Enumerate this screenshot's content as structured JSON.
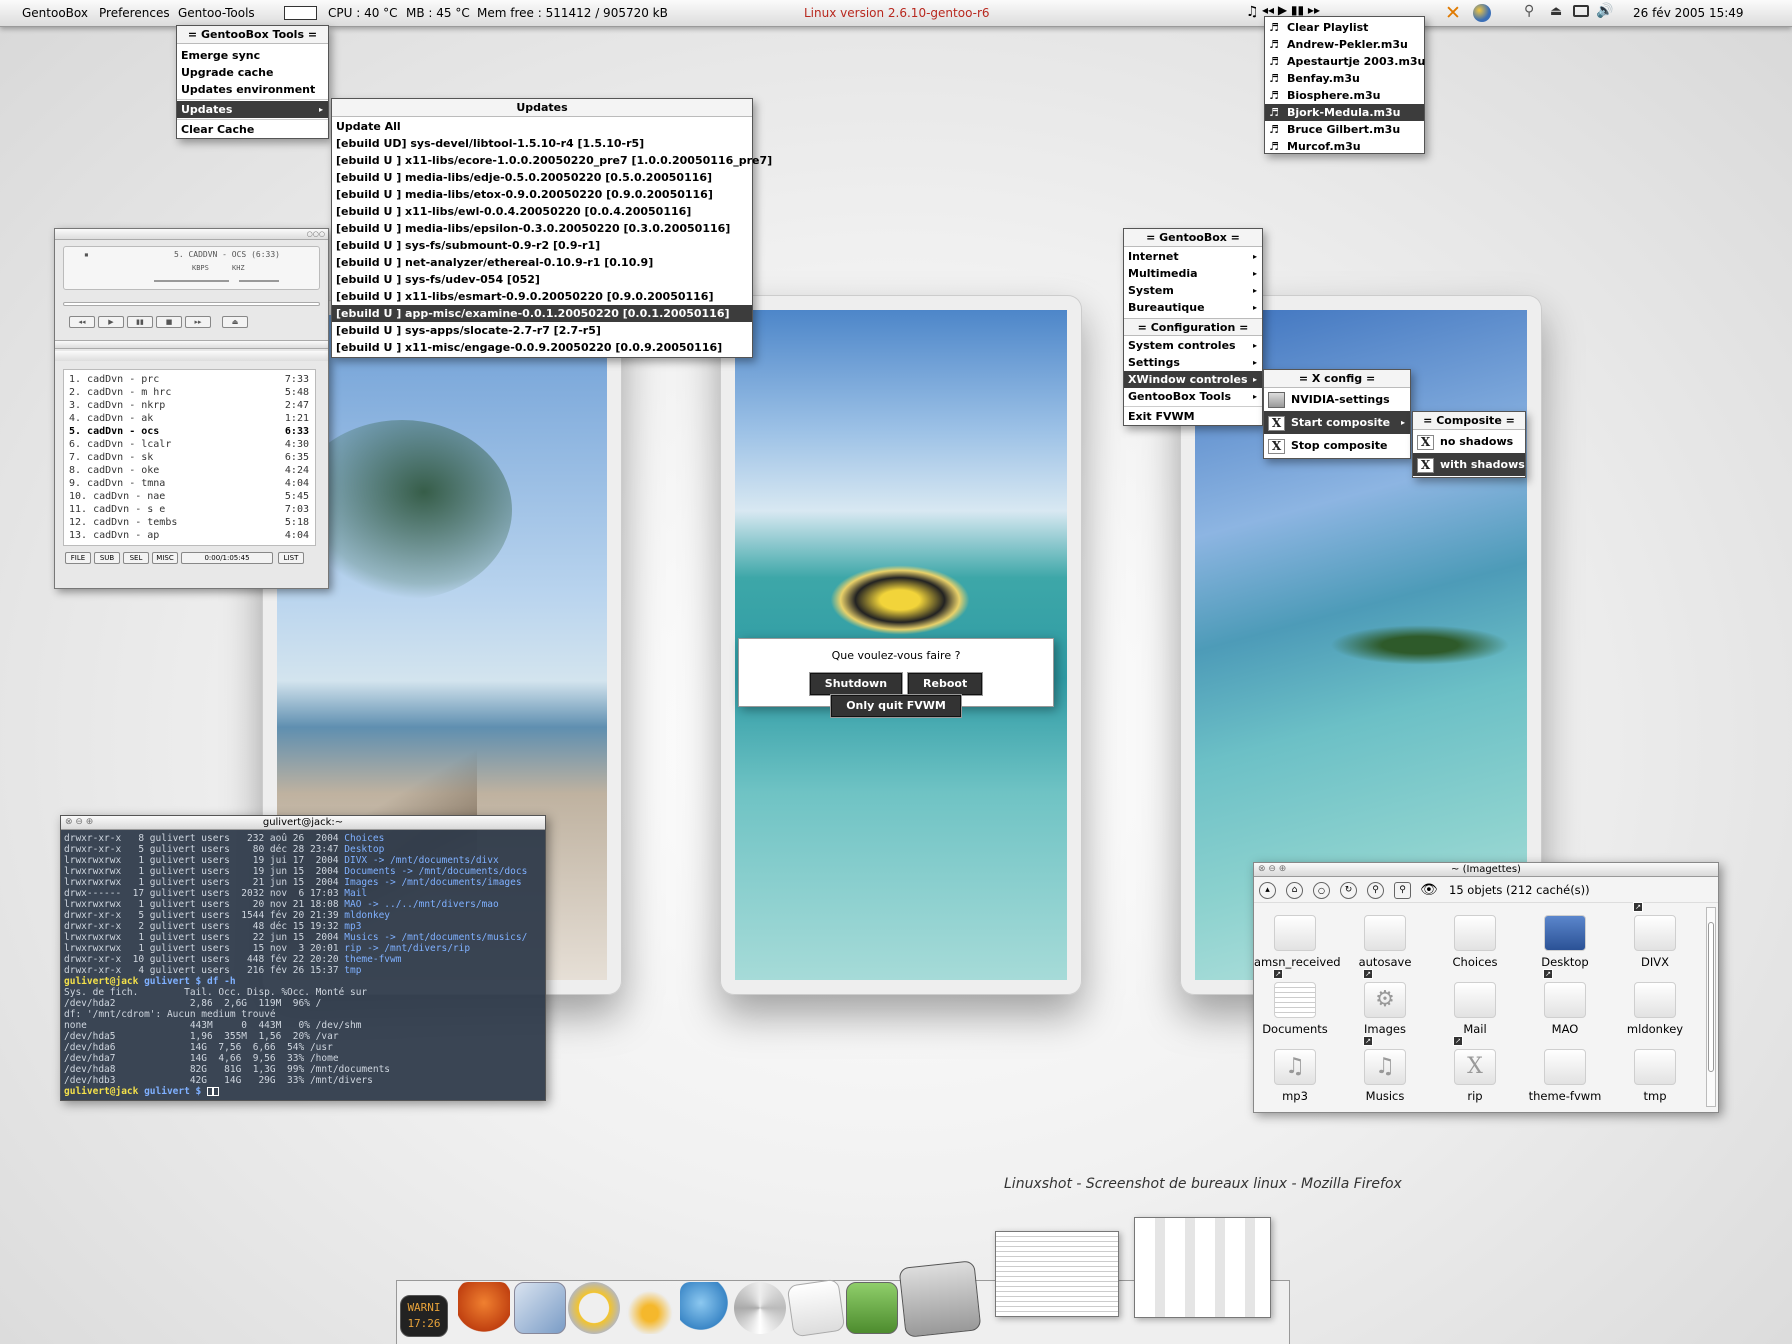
{
  "topbar": {
    "gentoobox": "GentooBox",
    "preferences": "Preferences",
    "gentoo_tools": "Gentoo-Tools",
    "cpu": "CPU : 40 °C",
    "mb": "MB : 45 °C",
    "mem": "Mem free : 511412 / 905720 kB",
    "kernel": "Linux version 2.6.10-gentoo-r6",
    "datetime": "26 fév 2005  15:49"
  },
  "tools_menu": {
    "title": "= GentooBox Tools =",
    "items": [
      "Emerge sync",
      "Upgrade cache",
      "Updates environment",
      "Updates",
      "Clear Cache"
    ]
  },
  "updates_menu": {
    "title": "Updates",
    "items": [
      "Update All",
      "[ebuild   UD] sys-devel/libtool-1.5.10-r4 [1.5.10-r5]",
      "[ebuild   U ] x11-libs/ecore-1.0.0.20050220_pre7 [1.0.0.20050116_pre7]",
      "[ebuild   U ] media-libs/edje-0.5.0.20050220 [0.5.0.20050116]",
      "[ebuild   U ] media-libs/etox-0.9.0.20050220 [0.9.0.20050116]",
      "[ebuild   U ] x11-libs/ewl-0.0.4.20050220 [0.0.4.20050116]",
      "[ebuild   U ] media-libs/epsilon-0.3.0.20050220 [0.3.0.20050116]",
      "[ebuild   U ] sys-fs/submount-0.9-r2 [0.9-r1]",
      "[ebuild   U ] net-analyzer/ethereal-0.10.9-r1 [0.10.9]",
      "[ebuild   U ] sys-fs/udev-054 [052]",
      "[ebuild   U ] x11-libs/esmart-0.9.0.20050220 [0.9.0.20050116]",
      "[ebuild   U ] app-misc/examine-0.0.1.20050220 [0.0.1.20050116]",
      "[ebuild   U ] sys-apps/slocate-2.7-r7 [2.7-r5]",
      "[ebuild   U ] x11-misc/engage-0.0.9.20050220 [0.0.9.20050116]"
    ]
  },
  "playlist_menu": {
    "items": [
      "Clear Playlist",
      "Andrew-Pekler.m3u",
      "Apestaurtje 2003.m3u",
      "Benfay.m3u",
      "Biosphere.m3u",
      "Bjork-Medula.m3u",
      "Bruce Gilbert.m3u",
      "Murcof.m3u"
    ]
  },
  "gb_menu": {
    "title": "= GentooBox =",
    "items": [
      "Internet",
      "Multimedia",
      "System",
      "Bureautique"
    ],
    "config_title": "= Configuration =",
    "config_items": [
      "System controles",
      "Settings",
      "XWindow controles",
      "GentooBox Tools"
    ],
    "exit": "Exit FVWM"
  },
  "xconfig_menu": {
    "title": "= X config =",
    "items": [
      "NVIDIA-settings",
      "Start composite",
      "Stop composite"
    ]
  },
  "composite_menu": {
    "title": "= Composite =",
    "items": [
      "no shadows",
      "with shadows"
    ]
  },
  "xmms": {
    "display": "5. CADDVN - OCS (6:33)",
    "kbps": "KBPS",
    "khz": "KHZ",
    "tracks": [
      {
        "n": "1. cadDvn - prc",
        "t": "7:33"
      },
      {
        "n": "2. cadDvn - m hrc",
        "t": "5:48"
      },
      {
        "n": "3. cadDvn - nkrp",
        "t": "2:47"
      },
      {
        "n": "4. cadDvn - ak",
        "t": "1:21"
      },
      {
        "n": "5. cadDvn - ocs",
        "t": "6:33"
      },
      {
        "n": "6. cadDvn - lcalr",
        "t": "4:30"
      },
      {
        "n": "7. cadDvn - sk",
        "t": "6:35"
      },
      {
        "n": "8. cadDvn - oke",
        "t": "4:24"
      },
      {
        "n": "9. cadDvn - tmna",
        "t": "4:04"
      },
      {
        "n": "10. cadDvn - nae",
        "t": "5:45"
      },
      {
        "n": "11. cadDvn - s e",
        "t": "7:03"
      },
      {
        "n": "12. cadDvn - tembs",
        "t": "5:18"
      },
      {
        "n": "13. cadDvn -  ap",
        "t": "4:04"
      }
    ],
    "buttons": [
      "FILE",
      "SUB",
      "SEL",
      "MISC"
    ],
    "time": "0:00/1:05:45",
    "list": "LIST"
  },
  "dialog": {
    "question": "Que voulez-vous faire ?",
    "shutdown": "Shutdown",
    "reboot": "Reboot",
    "quit": "Only quit FVWM"
  },
  "terminal": {
    "title": "gulivert@jack:~",
    "lines": [
      [
        "drwxr-xr-x   8 gulivert users   232 aoû 26  2004 ",
        "Choices"
      ],
      [
        "drwxr-xr-x   5 gulivert users    80 déc 28 23:47 ",
        "Desktop"
      ],
      [
        "lrwxrwxrwx   1 gulivert users    19 jui 17  2004 ",
        "DIVX -> /mnt/documents/divx"
      ],
      [
        "lrwxrwxrwx   1 gulivert users    19 jun 15  2004 ",
        "Documents -> /mnt/documents/docs"
      ],
      [
        "lrwxrwxrwx   1 gulivert users    21 jun 15  2004 ",
        "Images -> /mnt/documents/images"
      ],
      [
        "drwx------  17 gulivert users  2032 nov  6 17:03 ",
        "Mail"
      ],
      [
        "lrwxrwxrwx   1 gulivert users    20 nov 21 18:08 ",
        "MAO -> ../../mnt/divers/mao"
      ],
      [
        "drwxr-xr-x   5 gulivert users  1544 fév 20 21:39 ",
        "mldonkey"
      ],
      [
        "drwxr-xr-x   2 gulivert users    48 déc 15 19:32 ",
        "mp3"
      ],
      [
        "lrwxrwxrwx   1 gulivert users    22 jun 15  2004 ",
        "Musics -> /mnt/documents/musics/"
      ],
      [
        "lrwxrwxrwx   1 gulivert users    15 nov  3 20:01 ",
        "rip -> /mnt/divers/rip"
      ],
      [
        "drwxr-xr-x  10 gulivert users   448 fév 22 20:20 ",
        "theme-fvwm"
      ],
      [
        "drwxr-xr-x   4 gulivert users   216 fév 26 15:37 ",
        "tmp"
      ]
    ],
    "prompt1_user": "gulivert@jack",
    "prompt1_rest": " gulivert $ df -h",
    "df": [
      "Sys. de fich.        Tail. Occ. Disp. %Occ. Monté sur",
      "/dev/hda2             2,86  2,6G  119M  96% /",
      "df: '/mnt/cdrom': Aucun medium trouvé",
      "none                  443M     0  443M   0% /dev/shm",
      "/dev/hda5             1,96  355M  1,56  20% /var",
      "/dev/hda6             14G  7,56  6,66  54% /usr",
      "/dev/hda7             14G  4,66  9,56  33% /home",
      "/dev/hda8             82G   81G  1,3G  99% /mnt/documents",
      "/dev/hdb3             42G   14G   29G  33% /mnt/divers"
    ],
    "prompt2_user": "gulivert@jack",
    "prompt2_rest": " gulivert $ "
  },
  "filemanager": {
    "title": "~ (Imagettes)",
    "status": "15 objets (212 caché(s))",
    "icons": [
      "amsn_received",
      "autosave",
      "Choices",
      "Desktop",
      "DIVX",
      "Documents",
      "Images",
      "Mail",
      "MAO",
      "mldonkey",
      "mp3",
      "Musics",
      "rip",
      "theme-fvwm",
      "tmp"
    ]
  },
  "firefox_caption": "Linuxshot - Screenshot de bureaux linux - Mozilla Firefox",
  "dock": {
    "clock_text": "WARNI",
    "clock_time": "17:26"
  },
  "colors": {
    "menu_highlight": "#3c3c3c",
    "kernel_text": "#b8281e",
    "terminal_bg": "#2c3848",
    "term_dir": "#7fb0ff"
  }
}
